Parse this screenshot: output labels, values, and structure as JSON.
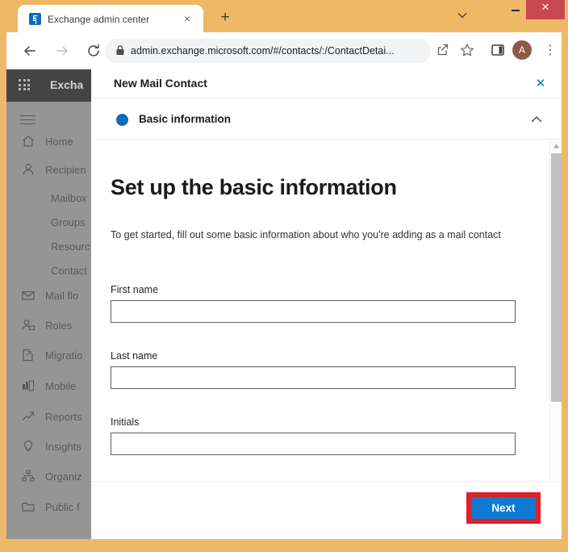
{
  "browser": {
    "tab": {
      "title": "Exchange admin center",
      "favicon": "exchange-icon",
      "close_label": "×"
    },
    "new_tab_label": "+",
    "tab_list_label": "⌄",
    "window_controls": {
      "minimize": "–",
      "maximize": "□",
      "close": "×"
    },
    "url": "admin.exchange.microsoft.com/#/contacts/:/ContactDetai...",
    "profile_initial": "A",
    "menu_label": "⋮"
  },
  "app": {
    "brand": "Excha",
    "sidebar": {
      "items": [
        {
          "label": "Home",
          "icon": "home-icon",
          "level": "top"
        },
        {
          "label": "Recipien",
          "icon": "person-icon",
          "level": "top"
        },
        {
          "label": "Mailbox",
          "icon": "",
          "level": "sub"
        },
        {
          "label": "Groups",
          "icon": "",
          "level": "sub"
        },
        {
          "label": "Resourc",
          "icon": "",
          "level": "sub"
        },
        {
          "label": "Contact",
          "icon": "",
          "level": "sub"
        },
        {
          "label": "Mail flo",
          "icon": "mail-icon",
          "level": "top"
        },
        {
          "label": "Roles",
          "icon": "roles-icon",
          "level": "top"
        },
        {
          "label": "Migratio",
          "icon": "migration-icon",
          "level": "top"
        },
        {
          "label": "Mobile",
          "icon": "mobile-icon",
          "level": "top"
        },
        {
          "label": "Reports",
          "icon": "reports-icon",
          "level": "top"
        },
        {
          "label": "Insights",
          "icon": "lightbulb-icon",
          "level": "top"
        },
        {
          "label": "Organiz",
          "icon": "org-icon",
          "level": "top"
        },
        {
          "label": "Public f",
          "icon": "folder-icon",
          "level": "top"
        }
      ]
    }
  },
  "modal": {
    "title": "New Mail Contact",
    "close_label": "✕",
    "section": {
      "label": "Basic information",
      "expanded": true
    },
    "heading": "Set up the basic information",
    "description": "To get started, fill out some basic information about who you're adding as a mail contact",
    "fields": [
      {
        "label": "First name",
        "value": "",
        "placeholder": ""
      },
      {
        "label": "Last name",
        "value": "",
        "placeholder": ""
      },
      {
        "label": "Initials",
        "value": "",
        "placeholder": ""
      }
    ],
    "footer": {
      "next_label": "Next"
    }
  },
  "colors": {
    "accent": "#0f6cbd",
    "button": "#0f7bd4",
    "highlight": "#e01f26",
    "window_frame": "#eeb868",
    "app_header": "#2b2b2b"
  }
}
